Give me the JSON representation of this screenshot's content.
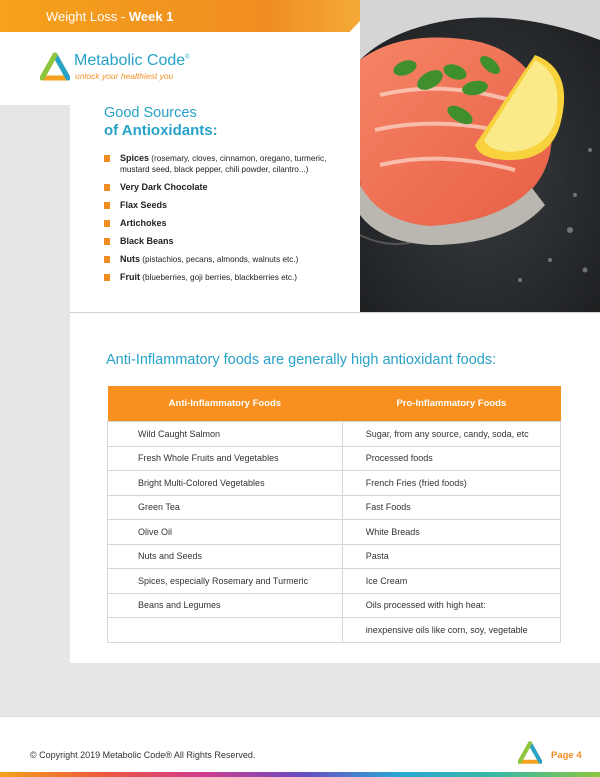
{
  "header": {
    "program": "Weight Loss - ",
    "week": "Week 1"
  },
  "logo": {
    "name": "Metabolic Code",
    "trademark": "®",
    "tagline": "unlock your healthiest you"
  },
  "photo": {
    "icon": "salmon-lemon-photo"
  },
  "sources": {
    "title_line1": "Good Sources",
    "title_line2": "of Antioxidants:",
    "items": [
      {
        "name": "Spices",
        "detail": " (rosemary, cloves, cinnamon, oregano, turmeric, mustard seed, black pepper, chili powder, cilantro...)"
      },
      {
        "name": "Very Dark Chocolate",
        "detail": ""
      },
      {
        "name": "Flax Seeds",
        "detail": ""
      },
      {
        "name": "Artichokes",
        "detail": ""
      },
      {
        "name": "Black Beans",
        "detail": ""
      },
      {
        "name": "Nuts",
        "detail": " (pistachios, pecans, almonds, walnuts etc.)"
      },
      {
        "name": "Fruit",
        "detail": " (blueberries, goji berries, blackberries etc.)"
      }
    ]
  },
  "section_heading": "Anti-Inflammatory foods are generally high antioxidant foods:",
  "table": {
    "headers": [
      "Anti-Inflammatory Foods",
      "Pro-Inflammatory Foods"
    ],
    "rows": [
      [
        "Wild Caught Salmon",
        "Sugar, from any source, candy, soda, etc"
      ],
      [
        "Fresh Whole Fruits and Vegetables",
        "Processed foods"
      ],
      [
        "Bright Multi-Colored Vegetables",
        "French Fries (fried foods)"
      ],
      [
        "Green Tea",
        "Fast Foods"
      ],
      [
        "Olive Oil",
        "White Breads"
      ],
      [
        "Nuts and Seeds",
        "Pasta"
      ],
      [
        "Spices, especially Rosemary and Turmeric",
        "Ice Cream"
      ],
      [
        "Beans and Legumes",
        "Oils processed with high heat:"
      ],
      [
        "",
        "inexpensive oils like corn, soy, vegetable"
      ]
    ]
  },
  "footer": {
    "copyright": "© Copyright 2019 Metabolic Code® All Rights Reserved.",
    "page": "Page 4"
  },
  "colors": {
    "accent_orange": "#f7901e",
    "brand_blue": "#27a2c8"
  }
}
